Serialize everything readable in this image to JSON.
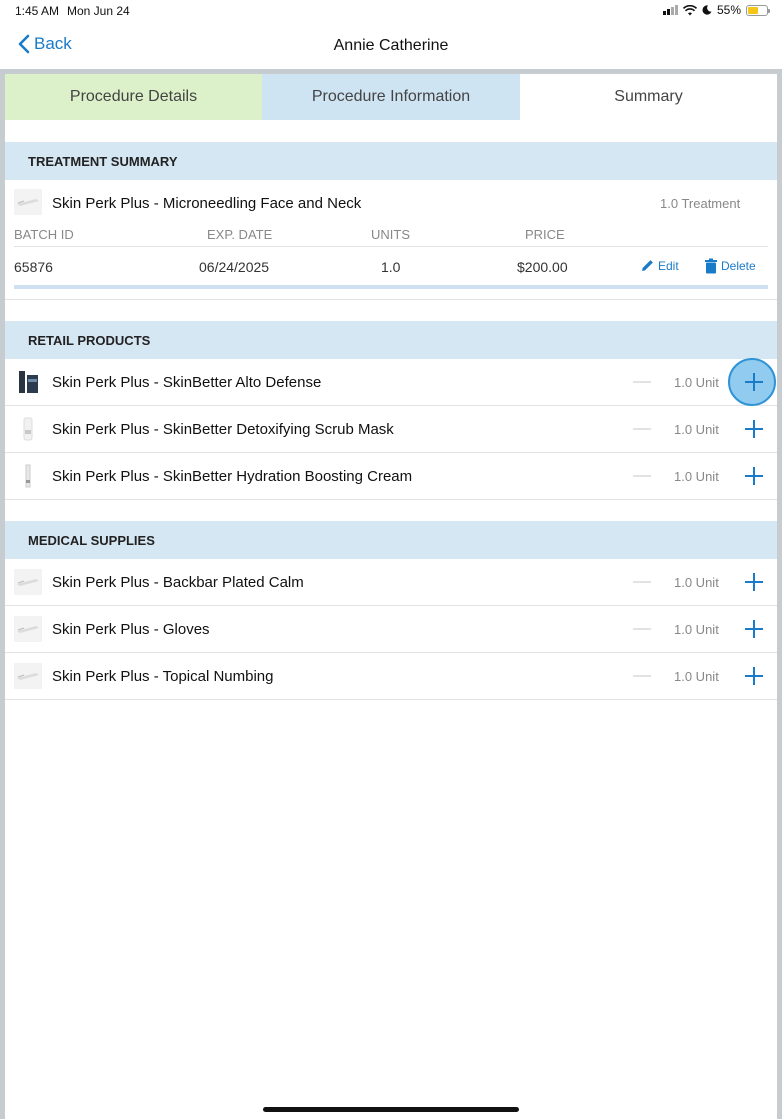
{
  "status_bar": {
    "time": "1:45 AM",
    "date": "Mon Jun 24",
    "battery": "55%"
  },
  "nav": {
    "back_label": "Back",
    "title": "Annie Catherine"
  },
  "tabs": [
    {
      "label": "Procedure Details"
    },
    {
      "label": "Procedure Information"
    },
    {
      "label": "Summary"
    }
  ],
  "treatment_summary": {
    "header": "TREATMENT SUMMARY",
    "name": "Skin Perk Plus - Microneedling Face and Neck",
    "quantity": "1.0 Treatment",
    "columns": [
      "BATCH ID",
      "EXP. DATE",
      "UNITS",
      "PRICE"
    ],
    "row": {
      "batch_id": "65876",
      "exp_date": "06/24/2025",
      "units": "1.0",
      "price": "$200.00"
    },
    "edit_label": "Edit",
    "delete_label": "Delete"
  },
  "retail_products": {
    "header": "RETAIL PRODUCTS",
    "items": [
      {
        "name": "Skin Perk Plus - SkinBetter Alto Defense",
        "quantity": "1.0 Unit"
      },
      {
        "name": "Skin Perk Plus - SkinBetter Detoxifying Scrub Mask",
        "quantity": "1.0 Unit"
      },
      {
        "name": "Skin Perk Plus - SkinBetter Hydration Boosting Cream",
        "quantity": "1.0 Unit"
      }
    ]
  },
  "medical_supplies": {
    "header": "MEDICAL SUPPLIES",
    "items": [
      {
        "name": "Skin Perk Plus - Backbar Plated Calm",
        "quantity": "1.0 Unit"
      },
      {
        "name": "Skin Perk Plus - Gloves",
        "quantity": "1.0 Unit"
      },
      {
        "name": "Skin Perk Plus - Topical Numbing",
        "quantity": "1.0 Unit"
      }
    ]
  },
  "colors": {
    "accent": "#1a7bc9",
    "section_header": "#d6e7f4",
    "tab_details": "#dcf1c9",
    "tab_info": "#cfe4f3"
  }
}
